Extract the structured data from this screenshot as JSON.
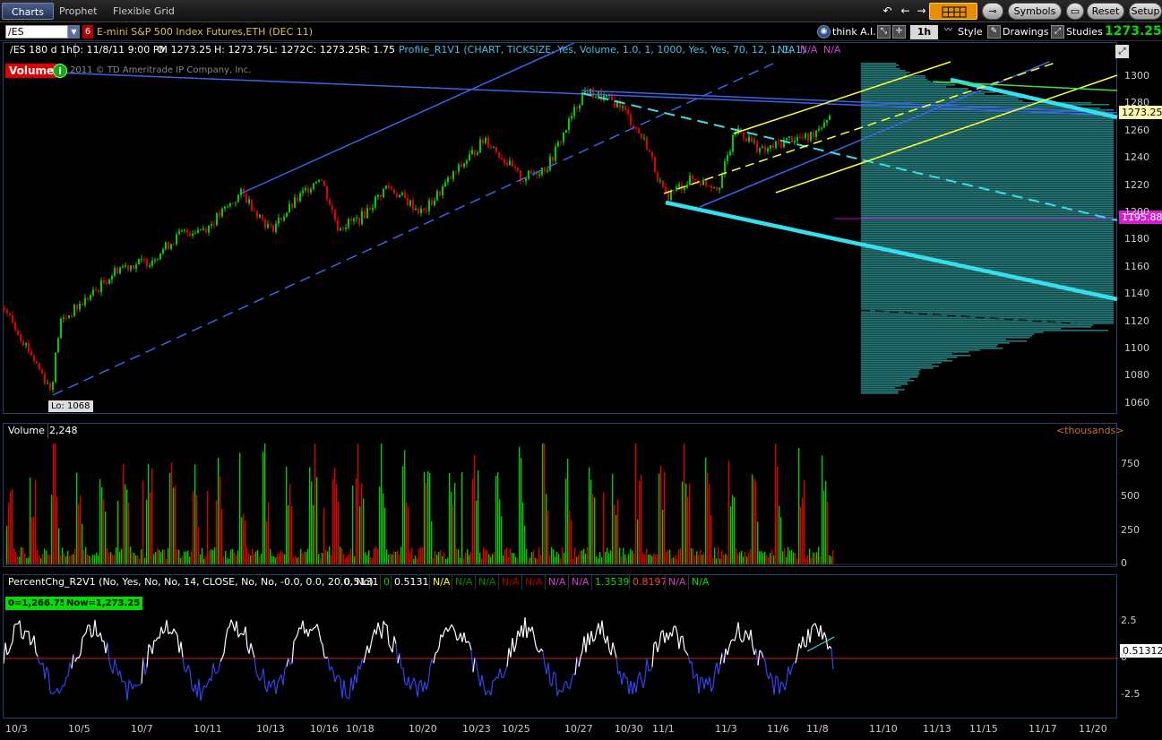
{
  "menu": {
    "tabs": [
      "Charts",
      "Prophet",
      "Flexible Grid"
    ],
    "symbols_label": "Symbols",
    "reset_label": "Reset",
    "setup_label": "Setup"
  },
  "toolbar": {
    "symbol": "/ES",
    "link_number": "6",
    "symbol_description": "E-mini S&P 500 Index Futures,ETH (DEC 11)",
    "think_ai": "think A.I.",
    "timeframe": "1h",
    "style_label": "Style",
    "drawings_label": "Drawings",
    "studies_label": "Studies",
    "last_price": "1273.25"
  },
  "price_panel": {
    "timeframe_label": "/ES 180 d 1h",
    "date": "D: 11/8/11 9:00 PM",
    "open": "O: 1273.25",
    "high": "H: 1273.75",
    "low": "L: 1272",
    "close": "C: 1273.25",
    "range": "R: 1.75",
    "study": "Profile_R1V1 (CHART, TICKSIZE, Yes, Volume, 1.0, 1, 1000, Yes, Yes, 70, 12, 1, 1, 1)",
    "na": [
      "N/A",
      "N/A",
      "N/A"
    ],
    "volume_badge": "Volume",
    "copyright": "2011 © TD Ameritrade IP Company, Inc.",
    "low_label": "Lo: 1068",
    "last_tag": "1273.25",
    "magenta_tag": "1195.88",
    "y_ticks": [
      "1300",
      "1280",
      "1260",
      "1240",
      "1220",
      "1200",
      "1180",
      "1160",
      "1140",
      "1120",
      "1100",
      "1080",
      "1060"
    ]
  },
  "volume_panel": {
    "label": "Volume",
    "value": "2,248",
    "units": "<thousands>",
    "y_ticks": [
      "750",
      "500",
      "250",
      "0"
    ]
  },
  "indicator_panel": {
    "study": "PercentChg_R2V1 (No, Yes, No, No, 14, CLOSE, No, No, -0.0, 0.0, 20.0, No)",
    "values": [
      "0.5131",
      "0",
      "0.5131",
      "N/A",
      "N/A",
      "N/A",
      "N/A",
      "N/A",
      "N/A",
      "N/A",
      "1.3539",
      "0.8197",
      "N/A",
      "N/A"
    ],
    "zero_badge": "0=1,266.75",
    "now_badge": "Now=1,273.25",
    "last_tag": "0.51312",
    "y_ticks": [
      "2.5",
      "0",
      "-2.5"
    ]
  },
  "x_ticks": [
    "10/3",
    "10/5",
    "10/7",
    "10/11",
    "10/13",
    "10/16",
    "10/18",
    "10/20",
    "10/23",
    "10/25",
    "10/27",
    "10/30",
    "11/1",
    "11/3",
    "11/6",
    "11/8",
    "11/10",
    "11/13",
    "11/15",
    "11/17",
    "11/20"
  ],
  "colors": {
    "up": "#00cc00",
    "down": "#dd0000",
    "channel_blue": "#3a64e8",
    "cyan": "#33e0ee",
    "yellow": "#ffff33",
    "magenta": "#cc00cc",
    "profile": "#2d8d8d"
  }
}
